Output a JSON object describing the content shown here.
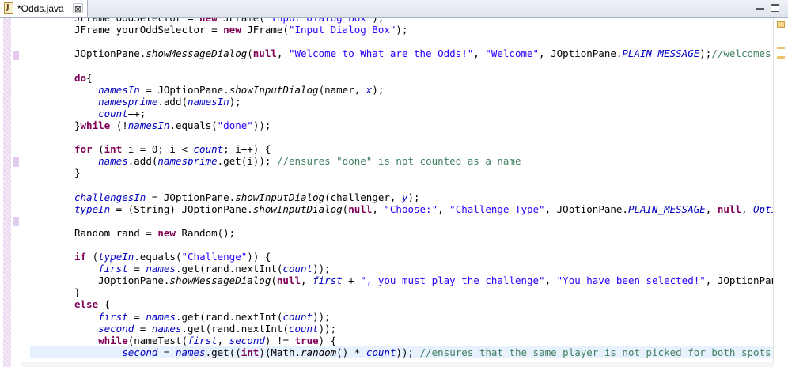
{
  "tab": {
    "title": "*Odds.java",
    "file_icon": "java-file-icon",
    "close_symbol": "⊠"
  },
  "window": {
    "minimize_icon": "minimize-icon",
    "maximize_icon": "maximize-icon"
  },
  "code_lines": [
    "JFrame OddSelector = new JFrame(\"Input Dialog Box\");",
    "JFrame yourOddSelector = new JFrame(\"Input Dialog Box\");",
    "",
    "JOptionPane.showMessageDialog(null, \"Welcome to What are the Odds!\", \"Welcome\", JOptionPane.PLAIN_MESSAGE);//welcomes users to",
    "",
    "do{",
    "    namesIn = JOptionPane.showInputDialog(namer, x);",
    "    namesprime.add(namesIn);",
    "    count++;",
    "}while (!namesIn.equals(\"done\"));",
    "",
    "for (int i = 0; i < count; i++) {",
    "    names.add(namesprime.get(i)); //ensures \"done\" is not counted as a name",
    "}",
    "",
    "challengesIn = JOptionPane.showInputDialog(challenger, y);",
    "typeIn = (String) JOptionPane.showInputDialog(null, \"Choose:\", \"Challenge Type\", JOptionPane.PLAIN_MESSAGE, null, Options, \"Cha",
    "",
    "Random rand = new Random();",
    "",
    "if (typeIn.equals(\"Challenge\")) {",
    "    first = names.get(rand.nextInt(count));",
    "    JOptionPane.showMessageDialog(null, first + \", you must play the challenge\", \"You have been selected!\", JOptionPane.PLAIN_M",
    "}",
    "else {",
    "    first = names.get(rand.nextInt(count));",
    "    second = names.get(rand.nextInt(count));",
    "    while(nameTest(first, second) != true) {",
    "        second = names.get((int)(Math.random() * count)); //ensures that the same player is not picked for both spots"
  ],
  "current_line_index": 28,
  "colors": {
    "keyword": "#7f0055",
    "field": "#0000c0",
    "string": "#2a00ff",
    "comment": "#3f7f5f",
    "current_line": "#e8f2fe"
  }
}
